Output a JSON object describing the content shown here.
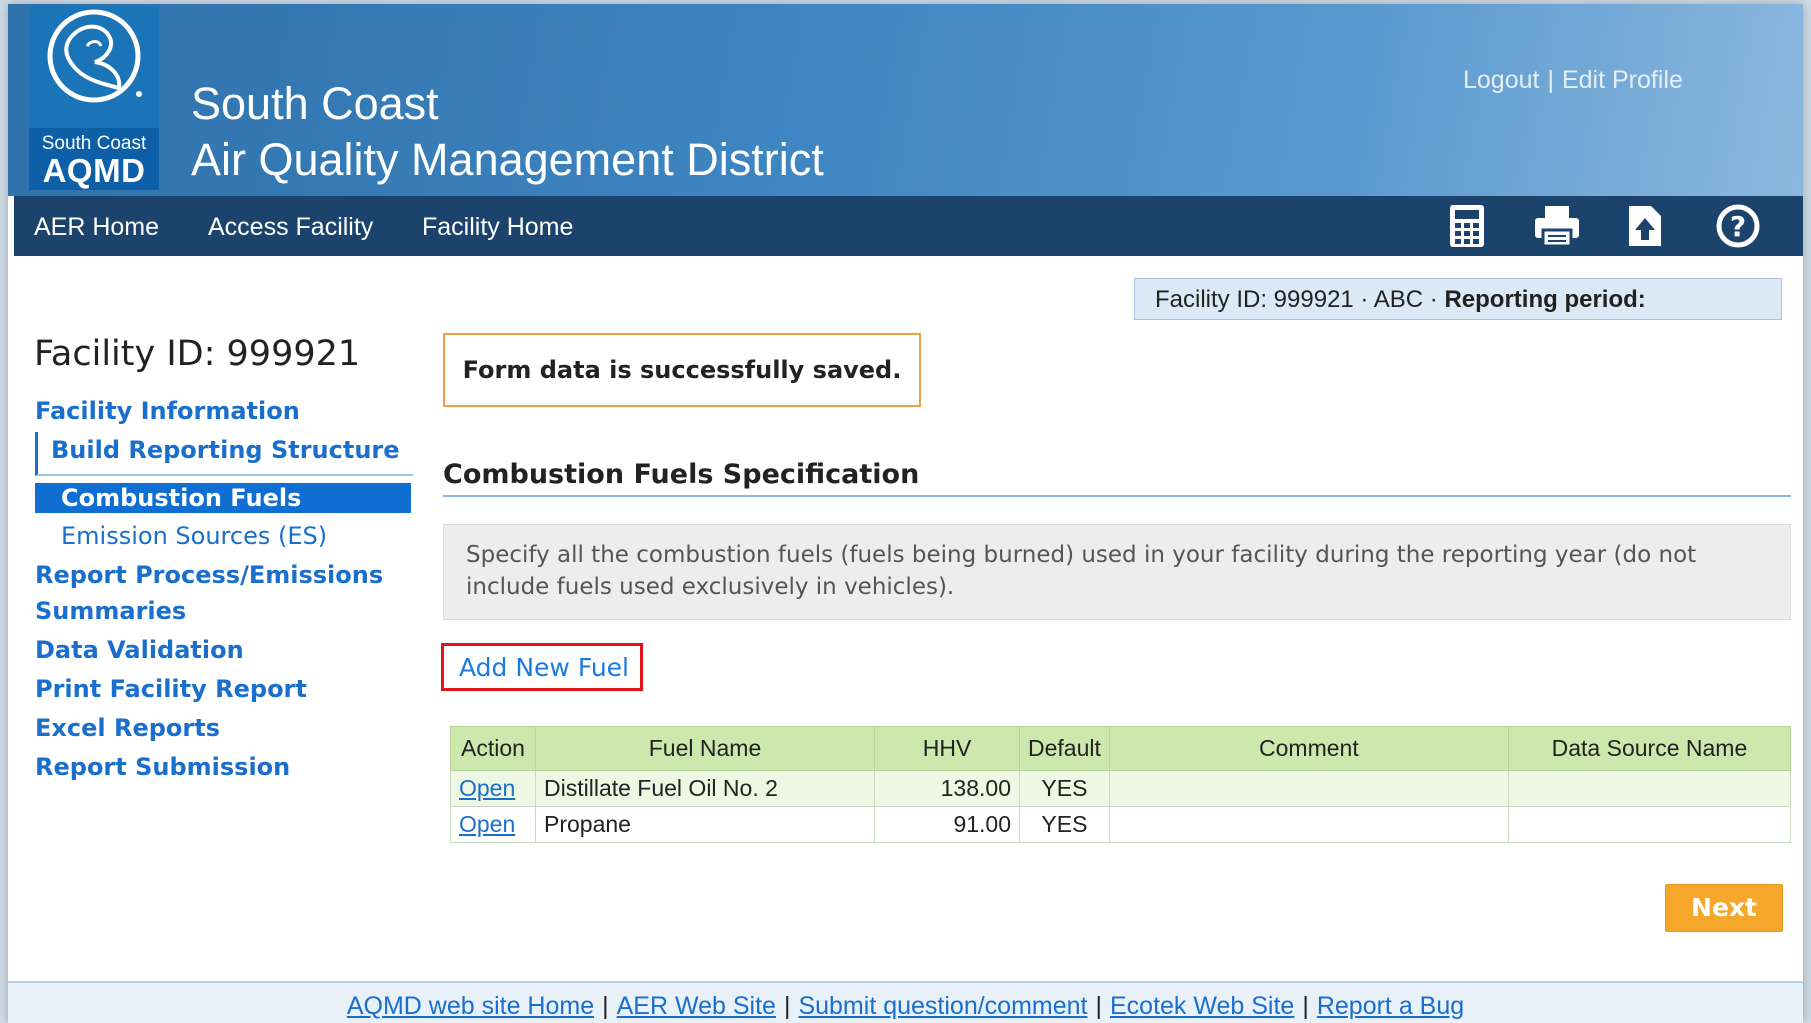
{
  "header": {
    "logo": {
      "sub": "South Coast",
      "main": "AQMD"
    },
    "title_line1": "South Coast",
    "title_line2": "Air Quality Management District",
    "links": {
      "logout": "Logout",
      "separator": "|",
      "edit_profile": "Edit Profile"
    }
  },
  "nav": {
    "items": [
      "AER Home",
      "Access Facility",
      "Facility Home"
    ],
    "tools": [
      "calculator-icon",
      "printer-icon",
      "upload-icon",
      "help-icon"
    ]
  },
  "facility_box": {
    "prefix": "Facility ID: 999921 · ABC · ",
    "period_label": "Reporting period:"
  },
  "sidebar": {
    "title": "Facility ID: 999921",
    "facility_information": "Facility Information",
    "build_reporting_structure": "Build Reporting Structure",
    "combustion_fuels": "Combustion Fuels",
    "emission_sources": "Emission Sources (ES)",
    "report_process": "Report Process/Emissions",
    "summaries": "Summaries",
    "data_validation": "Data Validation",
    "print_facility_report": "Print Facility Report",
    "excel_reports": "Excel Reports",
    "report_submission": "Report Submission"
  },
  "main": {
    "save_message": "Form data is successfully saved.",
    "section_title": "Combustion Fuels Specification",
    "instructions": "Specify all the combustion fuels (fuels being burned) used in your facility during the reporting year (do not include fuels used exclusively in vehicles).",
    "add_fuel": "Add New Fuel",
    "table": {
      "headers": [
        "Action",
        "Fuel Name",
        "HHV",
        "Default",
        "Comment",
        "Data Source Name"
      ],
      "rows": [
        {
          "action": "Open",
          "fuel_name": "Distillate Fuel Oil No. 2",
          "hhv": "138.00",
          "default": "YES",
          "comment": "",
          "data_source": ""
        },
        {
          "action": "Open",
          "fuel_name": "Propane",
          "hhv": "91.00",
          "default": "YES",
          "comment": "",
          "data_source": ""
        }
      ]
    },
    "next": "Next"
  },
  "footer": {
    "links": [
      "AQMD web site Home",
      "AER Web Site",
      "Submit question/comment",
      "Ecotek Web Site",
      "Report a Bug"
    ],
    "separator": "|"
  },
  "colors": {
    "header_blue": "#3f86c2",
    "nav_dark": "#1b436c",
    "link_blue": "#1a6fcc",
    "active_blue": "#0e6ed1",
    "table_header_green": "#cde8ad",
    "next_orange": "#f4a72a",
    "highlight_red": "#e0161b"
  }
}
